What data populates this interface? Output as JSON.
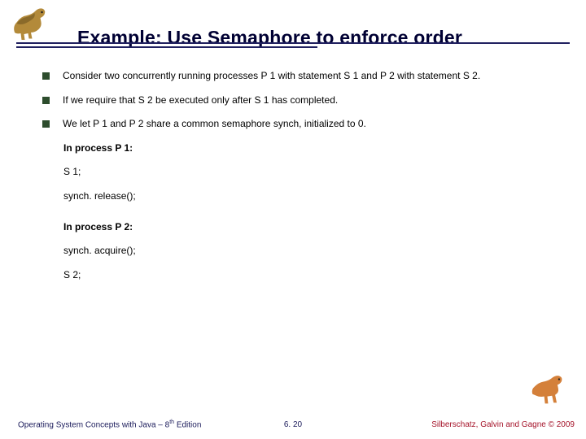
{
  "title": "Example: Use Semaphore to enforce order",
  "bullets": [
    "Consider two concurrently running processes P 1 with statement S 1 and P 2 with statement S 2.",
    "If we require that S 2 be executed only after S 1 has completed.",
    "We let P 1 and P 2 share a common semaphore synch, initialized to 0."
  ],
  "proc1": {
    "heading": "In process P 1:",
    "line1": "S 1;",
    "line2": "synch. release();"
  },
  "proc2": {
    "heading": "In process P 2:",
    "line1": "synch. acquire();",
    "line2": "S 2;"
  },
  "footer": {
    "left_a": "Operating System Concepts with Java – 8",
    "left_b": " Edition",
    "left_sup": "th",
    "center": "6. 20",
    "right": "Silberschatz, Galvin and Gagne © 2009"
  }
}
